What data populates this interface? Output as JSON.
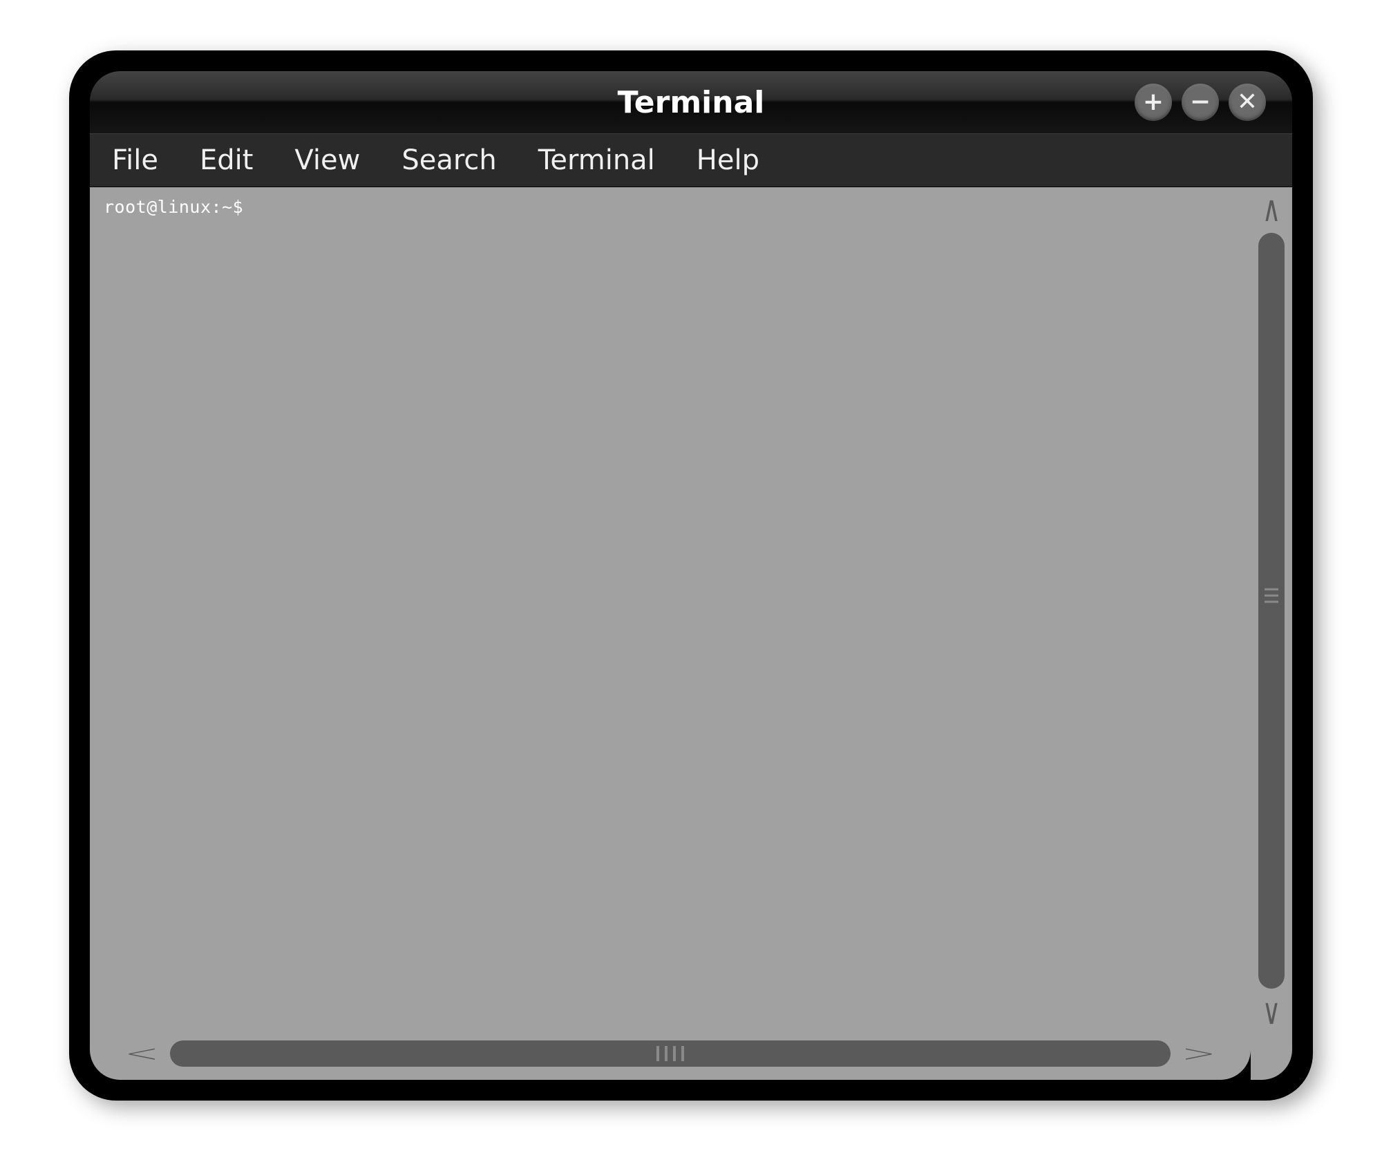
{
  "window": {
    "title": "Terminal"
  },
  "menubar": {
    "items": [
      "File",
      "Edit",
      "View",
      "Search",
      "Terminal",
      "Help"
    ]
  },
  "terminal": {
    "prompt": "root@linux:~$"
  },
  "titlebar_buttons": {
    "zoom_label": "+",
    "minimize_label": "−",
    "close_label": "✕"
  },
  "scroll": {
    "up": "∧",
    "down": "∨",
    "left": "<",
    "right": ">"
  }
}
